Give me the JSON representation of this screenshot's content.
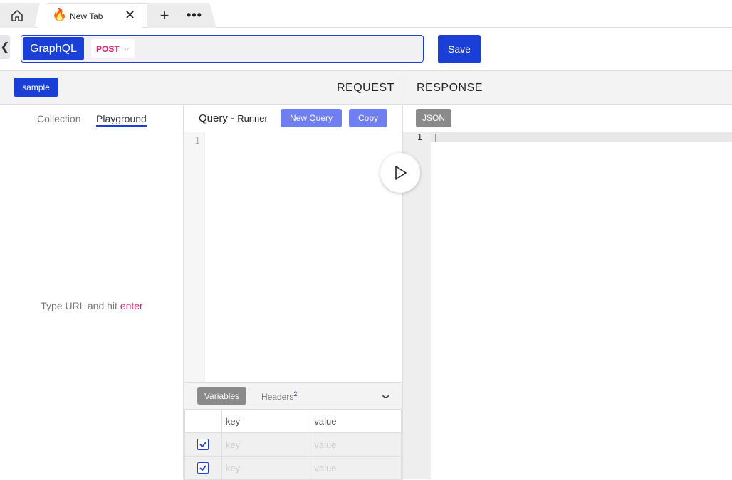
{
  "browser": {
    "tab_title": "New Tab",
    "tab_icon": "🔥",
    "close_glyph": "✕",
    "new_tab_glyph": "+",
    "more_glyph": "•••"
  },
  "urlbar": {
    "back_glyph": "❮",
    "type_label": "GraphQL",
    "method": "POST",
    "method_caret": "⌵",
    "url_value": "",
    "save_label": "Save"
  },
  "sections": {
    "sample_label": "sample",
    "request_title": "REQUEST",
    "response_title": "RESPONSE"
  },
  "left": {
    "tabs": [
      "Collection",
      "Playground"
    ],
    "active_tab": "Playground",
    "hint_prefix": "Type URL and hit",
    "hint_key": "enter"
  },
  "query": {
    "title": "Query -",
    "subtitle": "Runner",
    "new_query_label": "New Query",
    "copy_label": "Copy",
    "line_number": "1"
  },
  "variables": {
    "tab_variables": "Variables",
    "tab_headers": "Headers",
    "headers_count": "2",
    "collapse_glyph": "⌄",
    "col_key": "key",
    "col_value": "value",
    "rows": [
      {
        "key": "key",
        "value": "value",
        "checked": true
      },
      {
        "key": "key",
        "value": "value",
        "checked": true
      }
    ]
  },
  "response": {
    "format_label": "JSON",
    "line_number": "1"
  },
  "colors": {
    "accent": "#1a3fd6",
    "method": "#d6246e",
    "button_light": "#6f7ff2"
  }
}
